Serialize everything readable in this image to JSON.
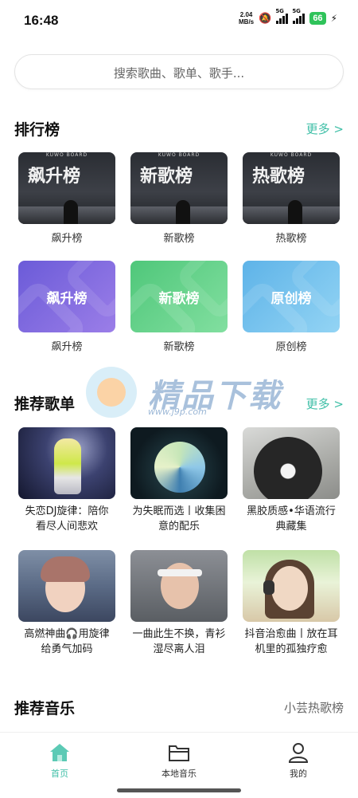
{
  "status_bar": {
    "time": "16:48",
    "net_speed_value": "2.04",
    "net_speed_unit": "MB/s",
    "sim1": "5G",
    "sim2": "5G",
    "battery": "66"
  },
  "search": {
    "placeholder": "搜索歌曲、歌单、歌手..."
  },
  "rankings": {
    "title": "排行榜",
    "more": "更多 >",
    "cards": [
      {
        "cover_text": "飙升榜",
        "brand": "KUWO BOARD",
        "label": "飙升榜"
      },
      {
        "cover_text": "新歌榜",
        "brand": "KUWO BOARD",
        "label": "新歌榜"
      },
      {
        "cover_text": "热歌榜",
        "brand": "KUWO BOARD",
        "label": "热歌榜"
      },
      {
        "cover_text": "飙升榜",
        "label": "飙升榜"
      },
      {
        "cover_text": "新歌榜",
        "label": "新歌榜"
      },
      {
        "cover_text": "原创榜",
        "label": "原创榜"
      }
    ]
  },
  "watermark": {
    "text": "精品下载",
    "url": "www.j9p.com"
  },
  "playlists": {
    "title": "推荐歌单",
    "more": "更多 >",
    "items": [
      {
        "line1": "失恋DJ旋律：陪你",
        "line2": "看尽人间悲欢"
      },
      {
        "line1": "为失眠而选丨收集困",
        "line2": "意的配乐"
      },
      {
        "line1": "黑胶质感•华语流行",
        "line2": "典藏集"
      },
      {
        "line1": "高燃神曲🎧用旋律",
        "line2": "给勇气加码"
      },
      {
        "line1": "一曲此生不换，青衫",
        "line2": "湿尽离人泪"
      },
      {
        "line1": "抖音治愈曲丨放在耳",
        "line2": "机里的孤独疗愈"
      }
    ]
  },
  "recommend_music": {
    "title": "推荐音乐",
    "side": "小芸热歌榜"
  },
  "bottom_nav": {
    "items": [
      {
        "label": "首页",
        "icon": "home-icon",
        "active": true
      },
      {
        "label": "本地音乐",
        "icon": "folder-icon",
        "active": false
      },
      {
        "label": "我的",
        "icon": "person-icon",
        "active": false
      }
    ]
  },
  "colors": {
    "accent": "#3fbfa7"
  }
}
